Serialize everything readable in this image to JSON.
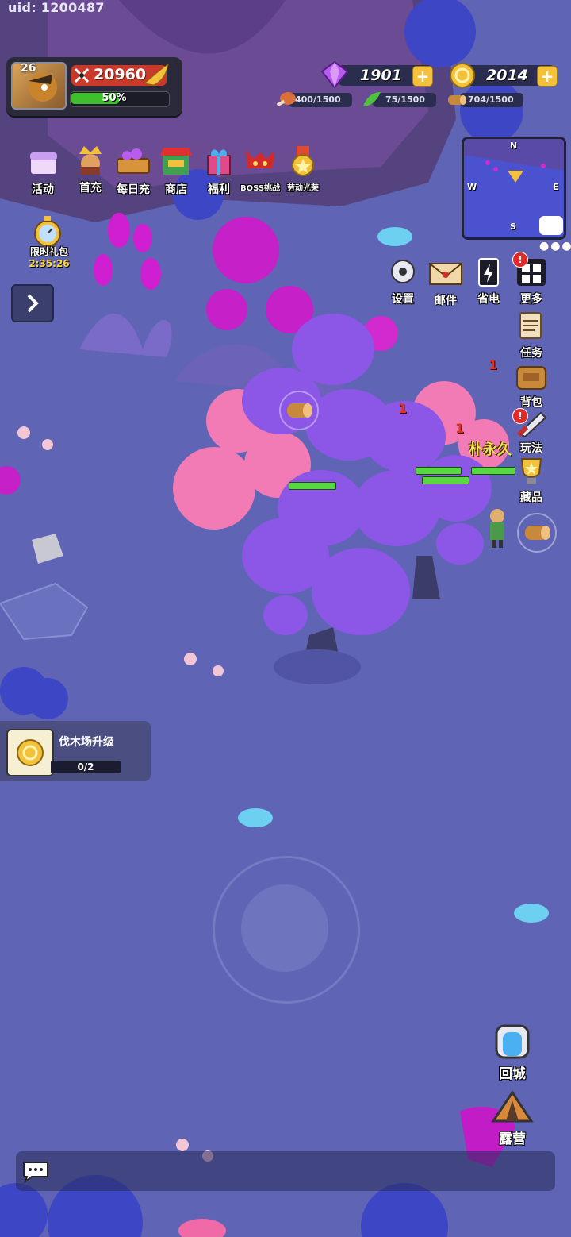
{
  "uid": "uid: 1200487",
  "player": {
    "level": "26",
    "power": "20960",
    "exp_percent": 0.5,
    "exp_label": "50%"
  },
  "currency": {
    "gems": "1901",
    "gold": "2014"
  },
  "resources": {
    "meat": "400/1500",
    "herb": "75/1500",
    "wood": "704/1500"
  },
  "top_menu": [
    {
      "label": "活动",
      "icon": "treasure-chest-icon"
    },
    {
      "label": "首充",
      "icon": "king-icon"
    },
    {
      "label": "每日充",
      "icon": "gem-cart-icon"
    },
    {
      "label": "商店",
      "icon": "shop-icon"
    },
    {
      "label": "福利",
      "icon": "gift-icon"
    },
    {
      "label": "BOSS挑战",
      "icon": "boss-icon"
    },
    {
      "label": "劳动光荣",
      "icon": "medal-icon"
    }
  ],
  "timer": {
    "label": "限时礼包",
    "time": "2:35:26"
  },
  "minimap": {
    "n": "N",
    "s": "S",
    "w": "W",
    "e": "E"
  },
  "utility": [
    {
      "label": "设置",
      "icon": "gear-icon"
    },
    {
      "label": "邮件",
      "icon": "mail-icon"
    },
    {
      "label": "省电",
      "icon": "battery-icon"
    },
    {
      "label": "更多",
      "icon": "grid-icon"
    }
  ],
  "right_menu": [
    {
      "label": "任务",
      "icon": "scroll-icon"
    },
    {
      "label": "背包",
      "icon": "backpack-icon"
    },
    {
      "label": "玩法",
      "icon": "sword-icon"
    },
    {
      "label": "藏品",
      "icon": "trophy-icon"
    }
  ],
  "task": {
    "title": "伐木场升级",
    "progress": "0/2"
  },
  "player_name": "朴永久",
  "damage": [
    "1",
    "1",
    "1"
  ],
  "bottom_buttons": [
    {
      "label": "回城",
      "icon": "portal-icon"
    },
    {
      "label": "露营",
      "icon": "tent-icon"
    }
  ],
  "colors": {
    "ground": "#5f64b4",
    "tree_purple": "#8a4fe0",
    "tree_pink": "#f06aa8",
    "hp": "#57d840",
    "gold": "#f3c23a"
  }
}
